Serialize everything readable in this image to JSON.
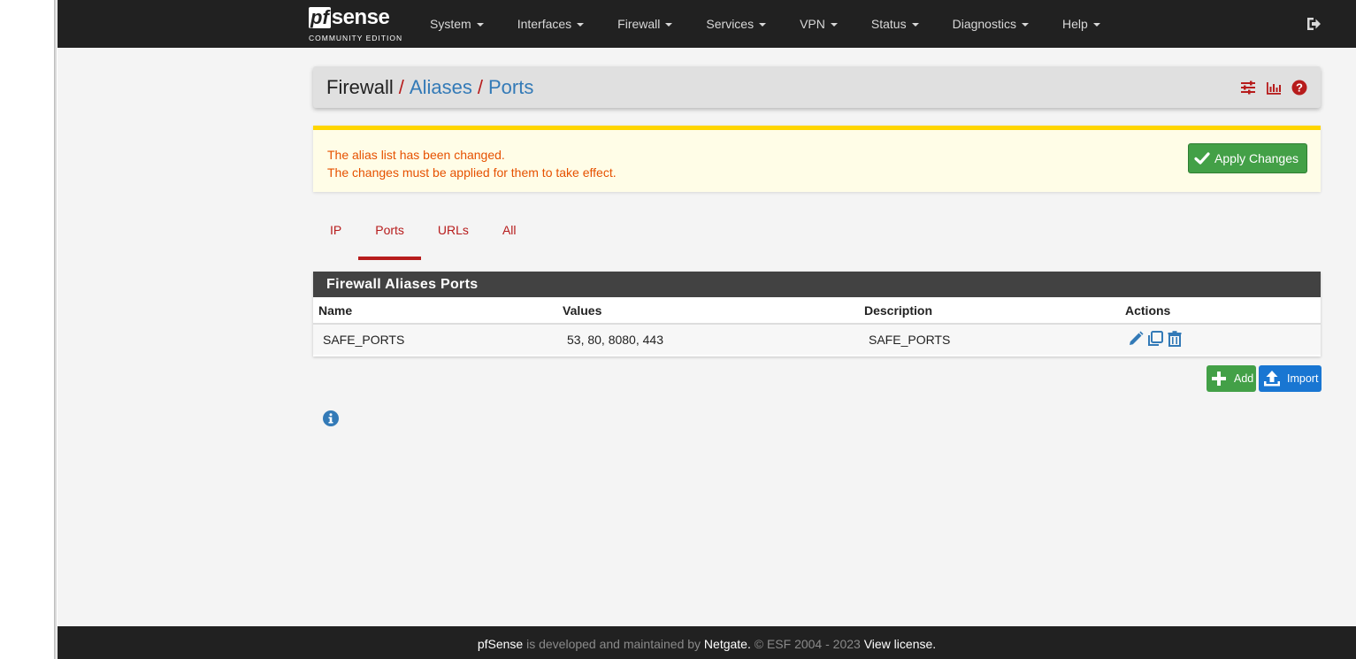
{
  "brand": {
    "name": "sense",
    "prefix": "pf",
    "edition": "COMMUNITY EDITION"
  },
  "nav": {
    "items": [
      {
        "label": "System"
      },
      {
        "label": "Interfaces"
      },
      {
        "label": "Firewall"
      },
      {
        "label": "Services"
      },
      {
        "label": "VPN"
      },
      {
        "label": "Status"
      },
      {
        "label": "Diagnostics"
      },
      {
        "label": "Help"
      }
    ],
    "logout_icon": "sign-out-icon"
  },
  "breadcrumb": {
    "root": "Firewall",
    "separator": "/",
    "level1": "Aliases",
    "level2": "Ports",
    "icons": [
      "sliders-icon",
      "bar-chart-icon",
      "help-icon"
    ]
  },
  "alert": {
    "line1": "The alias list has been changed.",
    "line2": "The changes must be applied for them to take effect.",
    "button_label": "Apply Changes"
  },
  "tabs": [
    {
      "label": "IP",
      "active": false
    },
    {
      "label": "Ports",
      "active": true
    },
    {
      "label": "URLs",
      "active": false
    },
    {
      "label": "All",
      "active": false
    }
  ],
  "table": {
    "title": "Firewall Aliases Ports",
    "columns": [
      "Name",
      "Values",
      "Description",
      "Actions"
    ],
    "rows": [
      {
        "name": "SAFE_PORTS",
        "values": "53, 80, 8080, 443",
        "description": "SAFE_PORTS",
        "actions": [
          "edit-icon",
          "copy-icon",
          "trash-icon"
        ]
      }
    ]
  },
  "buttons": {
    "add": "Add",
    "import": "Import"
  },
  "footer": {
    "product": "pfSense",
    "text1": " is developed and maintained by ",
    "company": "Netgate.",
    "text2": " © ESF 2004 - 2023 ",
    "license": "View license."
  },
  "colors": {
    "navbar": "#212121",
    "accent_red": "#b71c1c",
    "link_blue": "#337ab7",
    "success_green": "#43a047",
    "primary_blue": "#1976d2",
    "alert_text": "#e65100",
    "alert_border": "#ffd600"
  }
}
